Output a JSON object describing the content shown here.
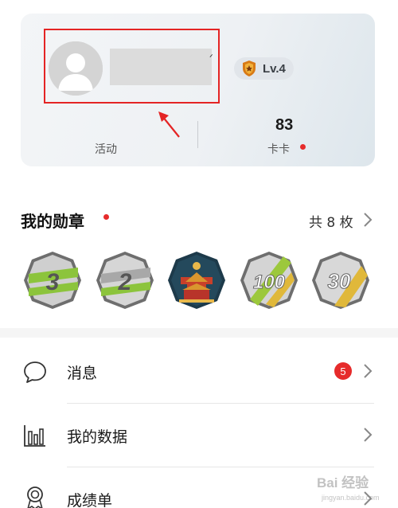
{
  "profile": {
    "level_label": "Lv.4",
    "stats": {
      "activity_label": "活动",
      "kaka_value": "83",
      "kaka_label": "卡卡"
    }
  },
  "medals": {
    "title": "我的勋章",
    "count_label": "共 8 枚",
    "items": [
      {
        "text": "3"
      },
      {
        "text": "2"
      },
      {
        "text": ""
      },
      {
        "text": "100"
      },
      {
        "text": "30"
      }
    ]
  },
  "menu": [
    {
      "label": "消息",
      "badge": "5"
    },
    {
      "label": "我的数据"
    },
    {
      "label": "成绩单"
    }
  ],
  "watermark": {
    "main": "Bai 经验",
    "sub": "jingyan.baidu.com"
  },
  "colors": {
    "accent_red": "#e62b2b",
    "annotation_red": "#e42424"
  }
}
